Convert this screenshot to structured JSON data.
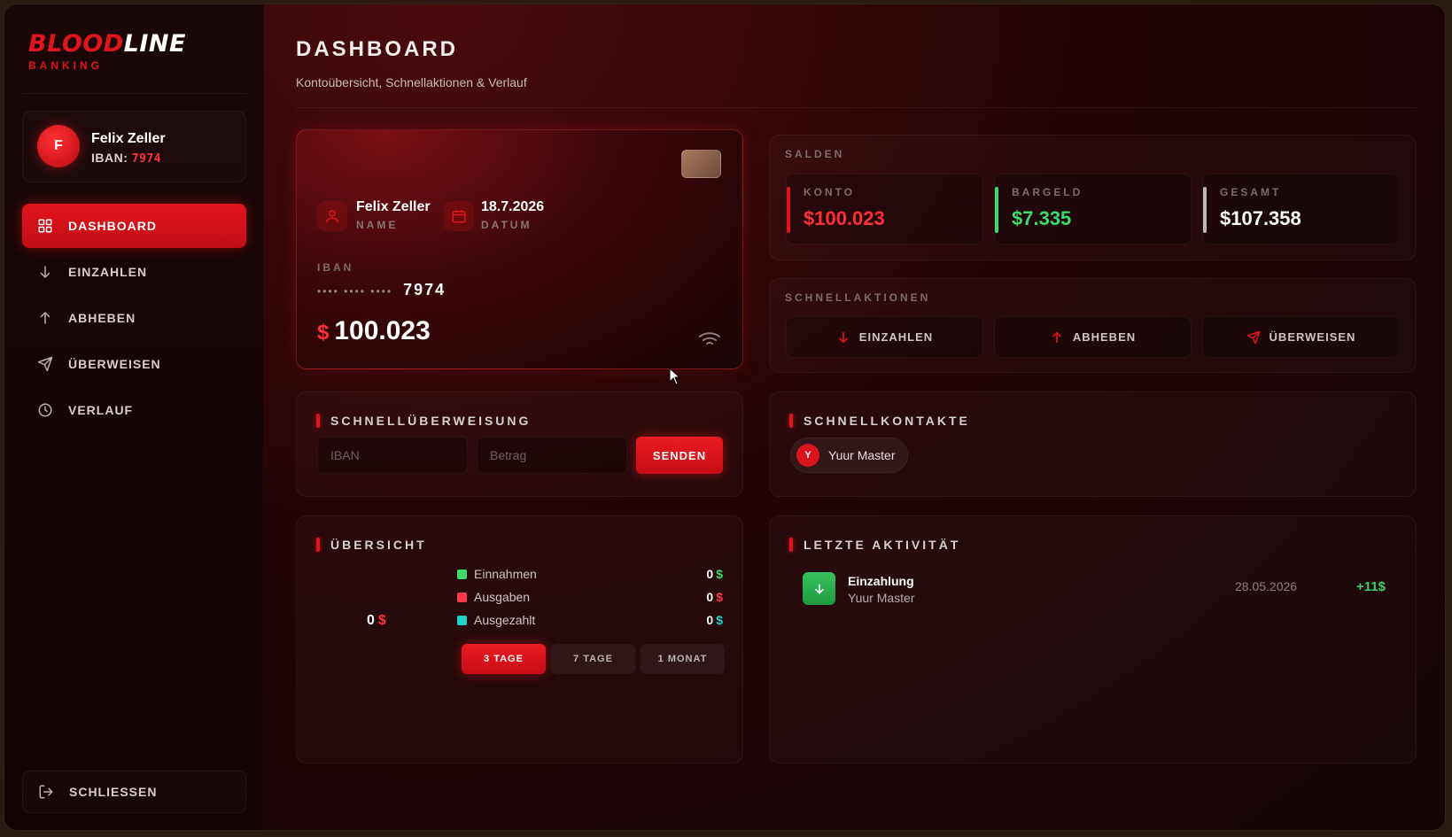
{
  "brand": {
    "name_part1": "BLOOD",
    "name_part2": "LINE",
    "subtitle": "BANKING"
  },
  "user": {
    "avatar_letter": "F",
    "name": "Felix Zeller",
    "iban_label": "IBAN:",
    "iban": "7974"
  },
  "sidebar": {
    "items": [
      {
        "label": "DASHBOARD",
        "icon": "grid-icon",
        "active": true
      },
      {
        "label": "EINZAHLEN",
        "icon": "arrow-down-icon",
        "active": false
      },
      {
        "label": "ABHEBEN",
        "icon": "arrow-up-icon",
        "active": false
      },
      {
        "label": "ÜBERWEISEN",
        "icon": "send-icon",
        "active": false
      },
      {
        "label": "VERLAUF",
        "icon": "clock-icon",
        "active": false
      }
    ],
    "close_label": "SCHLIESSEN"
  },
  "header": {
    "title": "DASHBOARD",
    "subtitle": "Kontoübersicht, Schnellaktionen & Verlauf"
  },
  "card": {
    "name": "Felix Zeller",
    "name_label": "NAME",
    "date": "18.7.2026",
    "date_label": "DATUM",
    "iban_label": "IBAN",
    "iban_mask": "•••• •••• ••••",
    "iban_last": "7974",
    "currency": "$",
    "balance": "100.023"
  },
  "salden": {
    "title": "SALDEN",
    "items": [
      {
        "label": "KONTO",
        "value": "$100.023",
        "color": "#ff2f37"
      },
      {
        "label": "BARGELD",
        "value": "$7.335",
        "color": "#3ddc6a"
      },
      {
        "label": "GESAMT",
        "value": "$107.358",
        "color": "#ffffff"
      }
    ]
  },
  "quick_actions": {
    "title": "SCHNELLAKTIONEN",
    "items": [
      {
        "label": "EINZAHLEN",
        "icon": "arrow-down-icon"
      },
      {
        "label": "ABHEBEN",
        "icon": "arrow-up-icon"
      },
      {
        "label": "ÜBERWEISEN",
        "icon": "send-icon"
      }
    ]
  },
  "quick_transfer": {
    "title": "SCHNELLÜBERWEISUNG",
    "iban_placeholder": "IBAN",
    "amount_placeholder": "Betrag",
    "send_label": "SENDEN"
  },
  "quick_contacts": {
    "title": "SCHNELLKONTAKTE",
    "contacts": [
      {
        "initial": "Y",
        "name": "Yuur Master"
      }
    ]
  },
  "overview": {
    "title": "ÜBERSICHT",
    "total": "0",
    "currency": "$",
    "rows": [
      {
        "label": "Einnahmen",
        "amount": "0",
        "currency": "$",
        "color": "#3ddc6a"
      },
      {
        "label": "Ausgaben",
        "amount": "0",
        "currency": "$",
        "color": "#ff3a4a"
      },
      {
        "label": "Ausgezahlt",
        "amount": "0",
        "currency": "$",
        "color": "#1ed2c8"
      }
    ],
    "ranges": [
      {
        "label": "3 TAGE",
        "active": true
      },
      {
        "label": "7 TAGE",
        "active": false
      },
      {
        "label": "1 MONAT",
        "active": false
      }
    ]
  },
  "activity": {
    "title": "LETZTE AKTIVITÄT",
    "items": [
      {
        "type": "Einzahlung",
        "counterparty": "Yuur Master",
        "date": "28.05.2026",
        "amount": "+11$"
      }
    ]
  }
}
